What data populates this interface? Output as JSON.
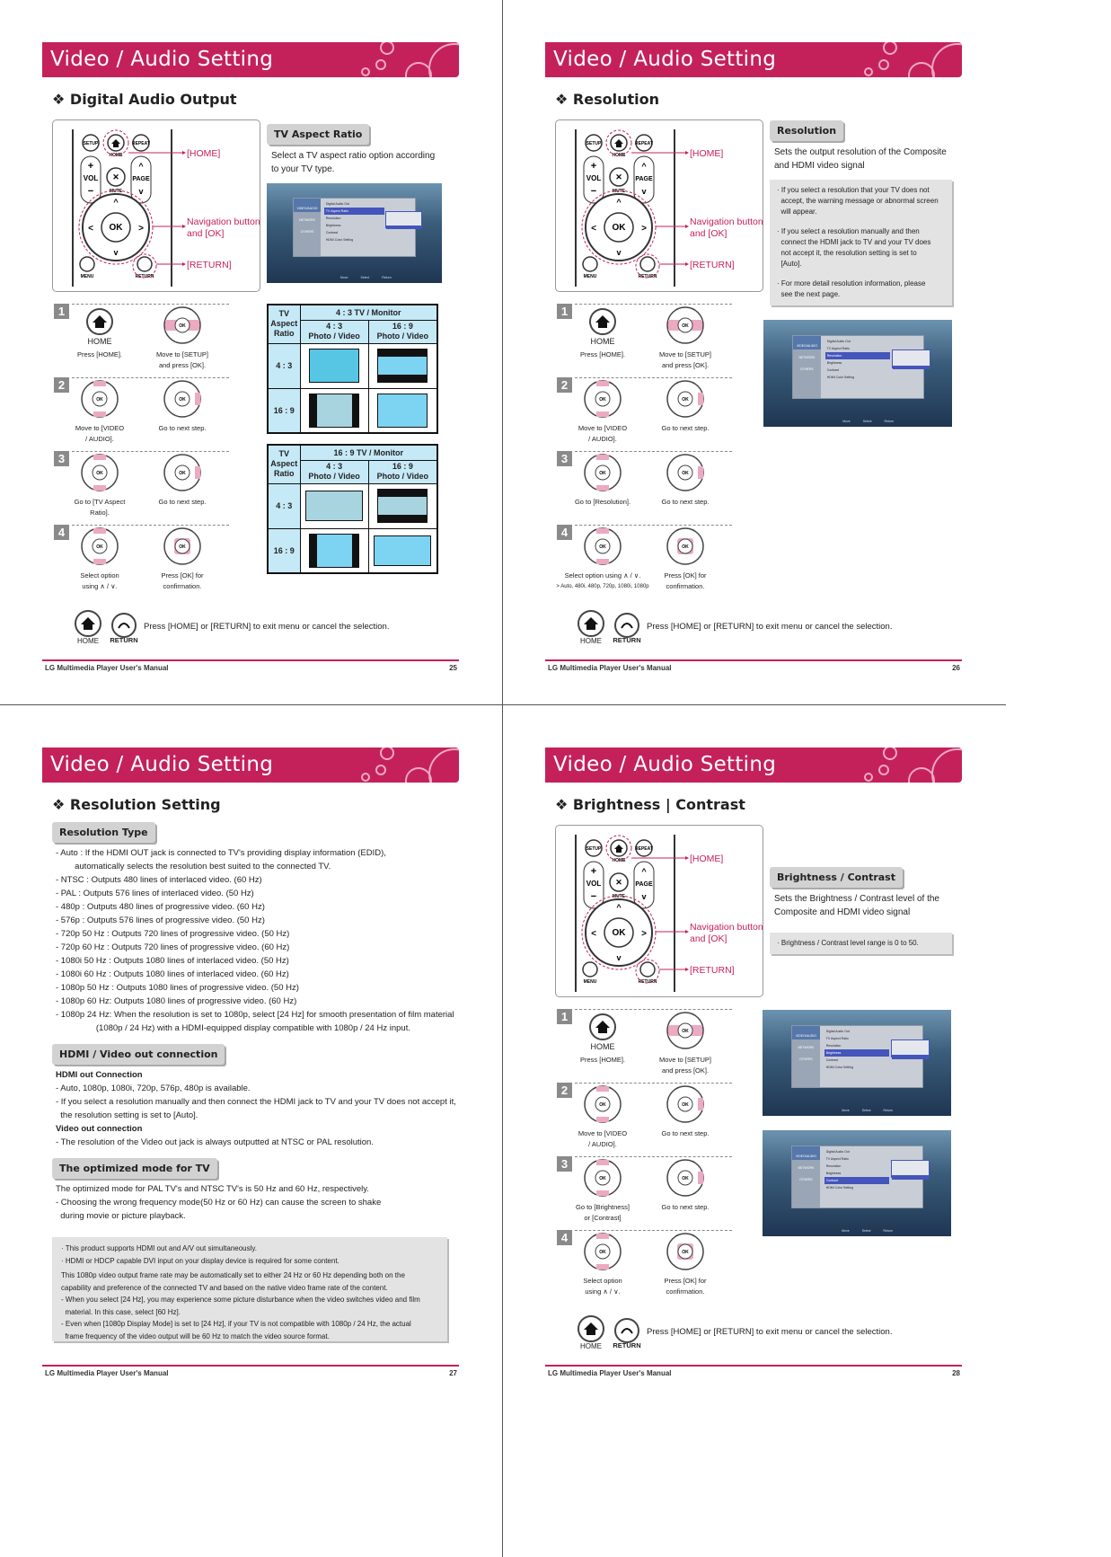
{
  "manual_title": "LG Multimedia Player User's Manual",
  "header_title": "Video / Audio Setting",
  "brand_color": "#c4215a",
  "remote": {
    "callouts": {
      "home": "[HOME]",
      "nav_1": "Navigation button",
      "nav_2": "and [OK]",
      "return": "[RETURN]"
    },
    "buttons": {
      "setup": "SETUP",
      "home": "HOME",
      "repeat": "REPEAT",
      "vol": "VOL",
      "mute": "MUTE",
      "page": "PAGE",
      "ok": "OK",
      "menu": "MENU",
      "return": "RETURN"
    }
  },
  "exit": {
    "text": "Press [HOME] or [RETURN] to exit menu or cancel the selection.",
    "home": "HOME",
    "return": "RETURN"
  },
  "osd": {
    "sidebar": [
      "VIDEO/AUDIO",
      "NETWORK",
      "OTHERS"
    ],
    "items": [
      "Digital Audio Out",
      "TV Aspect Ratio",
      "Resolution",
      "Brightness",
      "Contrast",
      "HDMI Color Setting"
    ],
    "hints": [
      "Move",
      "Select",
      "Return"
    ]
  },
  "pages": [
    {
      "number": "25",
      "section": "❖ Digital Audio Output",
      "tag": "TV Aspect Ratio",
      "desc": [
        "Select a TV aspect ratio option according",
        "to your TV type."
      ],
      "steps": [
        {
          "n": "1",
          "left_icon_label": "HOME",
          "left": [
            "Press [HOME]."
          ],
          "right": [
            "Move to [SETUP]",
            "and press [OK]."
          ]
        },
        {
          "n": "2",
          "left": [
            "Move to [VIDEO",
            "/ AUDIO]."
          ],
          "right": [
            "Go to next step."
          ]
        },
        {
          "n": "3",
          "left": [
            "Go to [TV Aspect",
            "Ratio]."
          ],
          "right": [
            "Go to next step."
          ]
        },
        {
          "n": "4",
          "left": [
            "Select option",
            "using ∧ / ∨."
          ],
          "right": [
            "Press [OK] for",
            "confirmation."
          ]
        }
      ],
      "tables": [
        {
          "corner": [
            "TV",
            "Aspect",
            "Ratio"
          ],
          "monitor": "4 : 3 TV / Monitor",
          "cols": [
            [
              "4 : 3",
              "Photo / Video"
            ],
            [
              "16 : 9",
              "Photo / Video"
            ]
          ],
          "rows": [
            "4 : 3",
            "16 : 9"
          ],
          "cells": [
            [
              {
                "fit": "full",
                "color": "#56c6e4"
              },
              {
                "fit": "letterbox",
                "color": "#7dd3f2"
              }
            ],
            [
              {
                "fit": "pillarbox",
                "color": "#a8d4e0"
              },
              {
                "fit": "full",
                "color": "#7dd3f2"
              }
            ]
          ]
        },
        {
          "corner": [
            "TV",
            "Aspect",
            "Ratio"
          ],
          "monitor": "16 : 9 TV / Monitor",
          "cols": [
            [
              "4 : 3",
              "Photo / Video"
            ],
            [
              "16 : 9",
              "Photo / Video"
            ]
          ],
          "rows": [
            "4 : 3",
            "16 : 9"
          ],
          "cells": [
            [
              {
                "fit": "wide",
                "color": "#a8d4e0"
              },
              {
                "fit": "letterbox",
                "color": "#a8d4e0"
              }
            ],
            [
              {
                "fit": "pillarbox",
                "color": "#7dd3f2"
              },
              {
                "fit": "wide",
                "color": "#7dd3f2"
              }
            ]
          ]
        }
      ]
    },
    {
      "number": "26",
      "section": "❖ Resolution",
      "tag": "Resolution",
      "desc": [
        "Sets the output resolution of the Composite",
        "and HDMI video signal"
      ],
      "notes": [
        [
          "· If you select a resolution that your TV does not",
          "  accept, the warning message or abnormal screen",
          "  will appear."
        ],
        [
          "· If you select a resolution manually and then",
          "  connect the HDMI jack to TV and your TV does",
          "  not accept it, the resolution setting is set to",
          "  [Auto]."
        ],
        [
          "· For more detail resolution information, please",
          "  see the next page."
        ]
      ],
      "steps": [
        {
          "n": "1",
          "left_icon_label": "HOME",
          "left": [
            "Press [HOME]."
          ],
          "right": [
            "Move to [SETUP]",
            "and press [OK]."
          ]
        },
        {
          "n": "2",
          "left": [
            "Move to [VIDEO",
            "/ AUDIO]."
          ],
          "right": [
            "Go to next step."
          ]
        },
        {
          "n": "3",
          "left": [
            "Go to [Resolution]."
          ],
          "right": [
            "Go to next step."
          ]
        },
        {
          "n": "4",
          "left": [
            "Select option using ∧ / ∨."
          ],
          "left_sub": "> Auto, 480i, 480p, 720p, 1080i, 1080p",
          "right": [
            "Press [OK] for",
            "confirmation."
          ]
        }
      ]
    },
    {
      "number": "27",
      "section": "❖ Resolution Setting",
      "blocks": [
        {
          "tag": "Resolution Type",
          "lines": [
            "- Auto : If the HDMI OUT jack is connected to TV's providing display information (EDID),",
            "        automatically selects the resolution best suited to the connected TV.",
            "- NTSC : Outputs 480 lines of interlaced video. (60 Hz)",
            "- PAL : Outputs 576 lines of interlaced video. (50 Hz)",
            "- 480p : Outputs 480 lines of progressive video. (60 Hz)",
            "- 576p : Outputs 576 lines of progressive video. (50 Hz)",
            "- 720p 50 Hz : Outputs 720 lines of progressive video. (50 Hz)",
            "- 720p 60 Hz : Outputs 720 lines of progressive video. (60 Hz)",
            "- 1080i 50 Hz : Outputs 1080 lines of interlaced video. (50 Hz)",
            "- 1080i 60 Hz : Outputs 1080 lines of interlaced video. (60 Hz)",
            "- 1080p 50 Hz : Outputs 1080 lines of progressive video. (50 Hz)",
            "- 1080p 60 Hz: Outputs 1080 lines of progressive video. (60 Hz)",
            "- 1080p 24 Hz: When the resolution is set to 1080p, select [24 Hz] for smooth presentation of film material",
            "                 (1080p / 24 Hz) with a HDMI-equipped display compatible with 1080p / 24 Hz input."
          ]
        },
        {
          "tag": "HDMI / Video out connection",
          "lines": [
            "*HDMI out Connection",
            "- Auto, 1080p, 1080i, 720p, 576p, 480p is available.",
            "- If you select a resolution manually and then connect the HDMI jack to TV and your TV does not accept it,",
            "  the resolution setting is set to [Auto].",
            "*Video out connection",
            "- The resolution of the Video out jack is always outputted at NTSC or PAL resolution."
          ]
        },
        {
          "tag": "The optimized mode for TV",
          "lines": [
            "The optimized mode for PAL TV's and NTSC TV's is 50 Hz and 60 Hz, respectively.",
            "- Choosing the wrong frequency mode(50 Hz or 60 Hz) can cause the screen to shake",
            "  during movie or picture playback."
          ]
        }
      ],
      "note": [
        "· This product supports HDMI out and A/V out simultaneously.",
        "· HDMI or HDCP capable DVI input on your display device is required for some content.",
        "This 1080p video output frame rate may be automatically set to either 24 Hz or 60 Hz depending both on the",
        "capability and preference of the connected TV and based on the native video frame rate of the content.",
        "- When you select [24 Hz], you may experience some picture disturbance when the video switches video and film",
        "  material. In this case, select [60 Hz].",
        "- Even when [1080p Display Mode] is set to [24 Hz], if your TV is not compatible with 1080p / 24 Hz, the actual",
        "  frame frequency of the video output will be 60 Hz to match the video source format."
      ]
    },
    {
      "number": "28",
      "section": "❖ Brightness | Contrast",
      "tag": "Brightness / Contrast",
      "desc": [
        "Sets the Brightness / Contrast level of the",
        "Composite and HDMI video signal"
      ],
      "notes": [
        [
          "· Brightness / Contrast level range is 0 to 50."
        ]
      ],
      "steps": [
        {
          "n": "1",
          "left_icon_label": "HOME",
          "left": [
            "Press [HOME]."
          ],
          "right": [
            "Move to [SETUP]",
            "and press [OK]."
          ]
        },
        {
          "n": "2",
          "left": [
            "Move to [VIDEO",
            "/ AUDIO]."
          ],
          "right": [
            "Go to next step."
          ]
        },
        {
          "n": "3",
          "left": [
            "Go to [Brightness]",
            "or [Contrast]"
          ],
          "right": [
            "Go to next step."
          ]
        },
        {
          "n": "4",
          "left": [
            "Select option",
            "using ∧ / ∨."
          ],
          "right": [
            "Press [OK] for",
            "confirmation."
          ]
        }
      ]
    }
  ]
}
